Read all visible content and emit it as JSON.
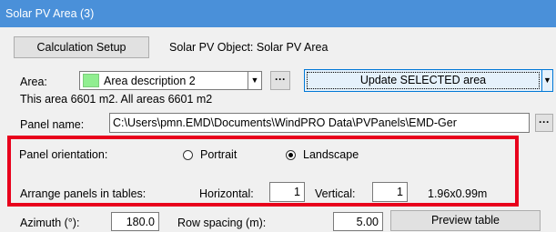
{
  "window": {
    "title": "Solar PV Area (3)"
  },
  "toolbar": {
    "calc_setup_label": "Calculation Setup",
    "object_label": "Solar PV Object: Solar PV Area"
  },
  "area": {
    "label": "Area:",
    "selected": "Area description 2",
    "swatch_color": "#90ee90",
    "browse_label": "···",
    "update_button": "Update SELECTED area",
    "summary": "This area 6601 m2. All areas 6601 m2"
  },
  "panel": {
    "name_label": "Panel name:",
    "name_value": "C:\\Users\\pmn.EMD\\Documents\\WindPRO Data\\PVPanels\\EMD-Ger",
    "browse_label": "···"
  },
  "orientation": {
    "label": "Panel orientation:",
    "options": [
      "Portrait",
      "Landscape"
    ],
    "selected": "Landscape"
  },
  "arrange": {
    "label": "Arrange panels in tables:",
    "horizontal_label": "Horizontal:",
    "horizontal_value": "1",
    "vertical_label": "Vertical:",
    "vertical_value": "1",
    "size_text": "1.96x0.99m"
  },
  "bottom": {
    "azimuth_label": "Azimuth (°):",
    "azimuth_value": "180.0",
    "row_spacing_label": "Row spacing (m):",
    "row_spacing_value": "5.00",
    "preview_button": "Preview table"
  },
  "colors": {
    "titlebar": "#4a90d9",
    "highlight_box": "#e8001c",
    "panel_bg": "#f0f0f0"
  }
}
